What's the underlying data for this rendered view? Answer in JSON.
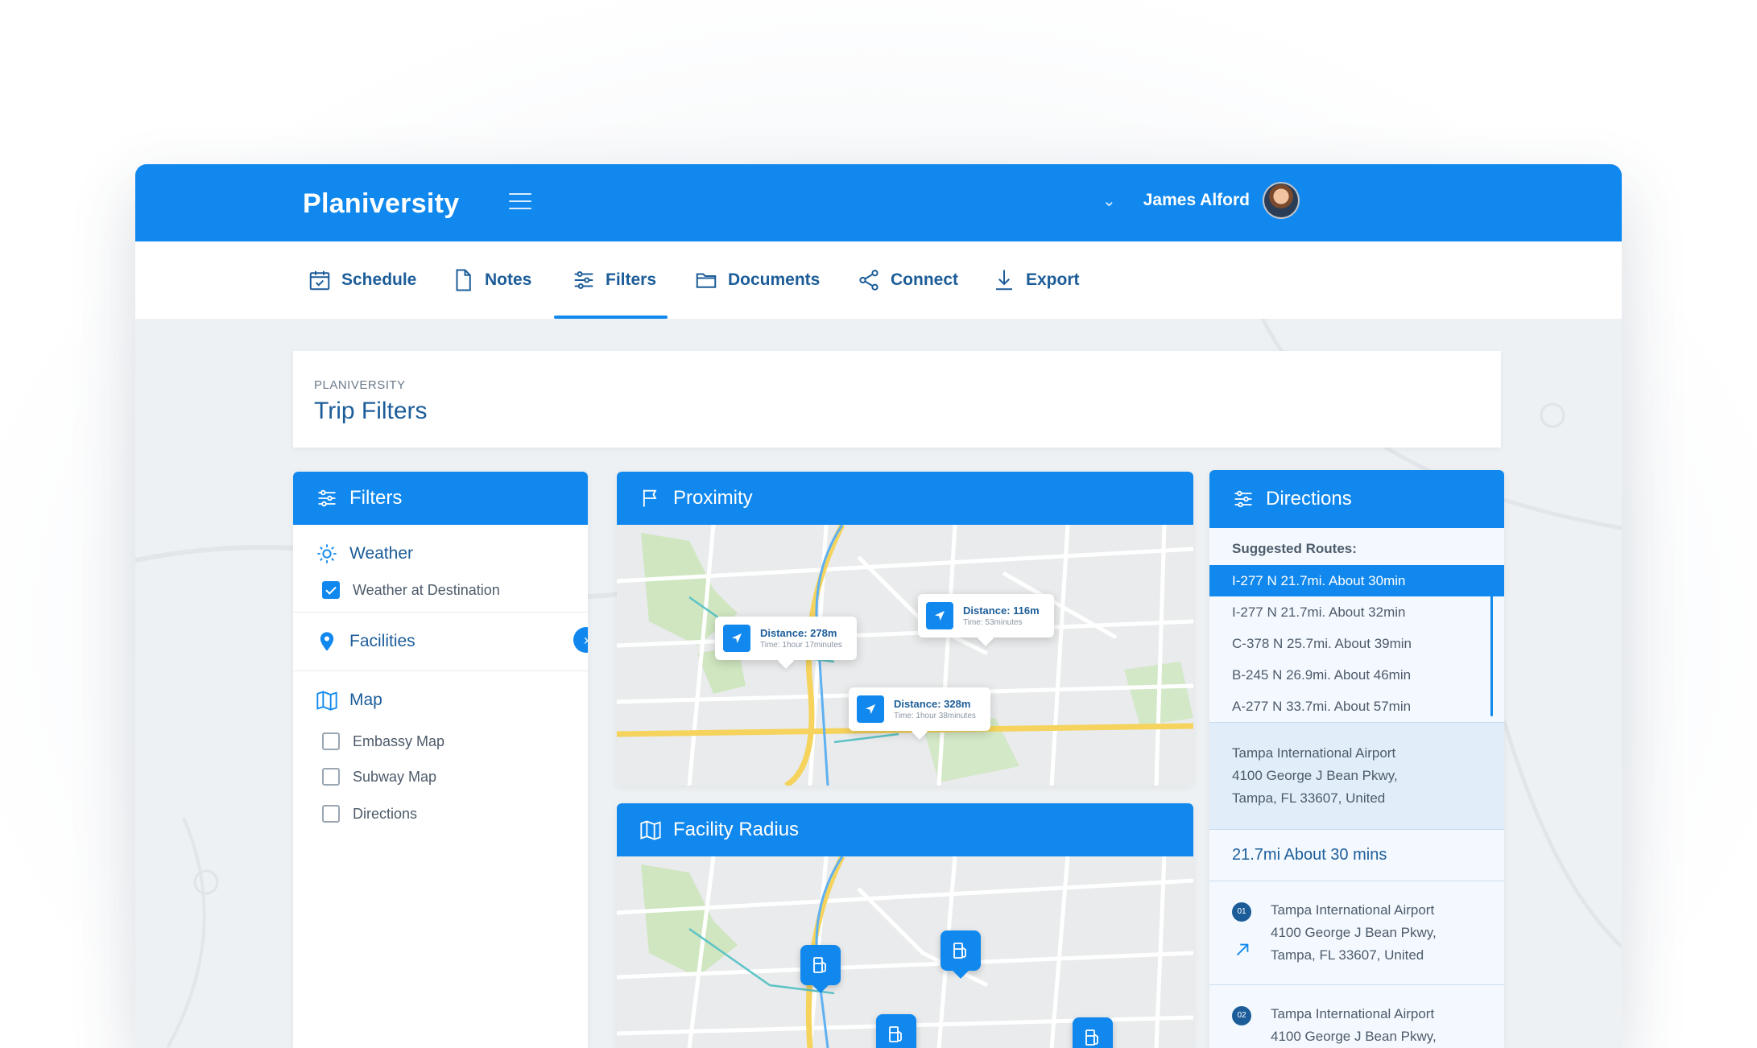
{
  "header": {
    "brand": "Planiversity",
    "user_name": "James Alford"
  },
  "tabs": [
    {
      "label": "Schedule"
    },
    {
      "label": "Notes"
    },
    {
      "label": "Filters"
    },
    {
      "label": "Documents"
    },
    {
      "label": "Connect"
    },
    {
      "label": "Export"
    }
  ],
  "active_tab": "Filters",
  "page": {
    "breadcrumb": "PLANIVERSITY",
    "title": "Trip Filters"
  },
  "filters": {
    "title": "Filters",
    "weather": {
      "label": "Weather",
      "options": [
        {
          "label": "Weather at Destination",
          "checked": true
        }
      ]
    },
    "facilities": {
      "label": "Facilities"
    },
    "map": {
      "label": "Map",
      "options": [
        {
          "label": "Embassy Map",
          "checked": false
        },
        {
          "label": "Subway Map",
          "checked": false
        },
        {
          "label": "Directions",
          "checked": false
        }
      ]
    }
  },
  "proximity": {
    "title": "Proximity",
    "markers": [
      {
        "distance": "Distance: 278m",
        "time": "Time: 1hour 17minutes"
      },
      {
        "distance": "Distance: 116m",
        "time": "Time: 53minutes"
      },
      {
        "distance": "Distance: 328m",
        "time": "Time: 1hour 38minutes"
      }
    ]
  },
  "facility_radius": {
    "title": "Facility Radius"
  },
  "directions": {
    "title": "Directions",
    "suggested_label": "Suggested Routes:",
    "routes": [
      {
        "label": "I-277 N 21.7mi. About 30min",
        "selected": true
      },
      {
        "label": "I-277 N 21.7mi. About 32min",
        "selected": false
      },
      {
        "label": "C-378 N 25.7mi. About 39min",
        "selected": false
      },
      {
        "label": "B-245 N 26.9mi. About 46min",
        "selected": false
      },
      {
        "label": "A-277 N 33.7mi. About 57min",
        "selected": false
      }
    ],
    "destination": {
      "line1": "Tampa International Airport",
      "line2": "4100 George J Bean Pkwy,",
      "line3": "Tampa, FL 33607, United"
    },
    "summary": "21.7mi About 30 mins",
    "steps": [
      {
        "num": "01",
        "line1": "Tampa International Airport",
        "line2": "4100 George J Bean Pkwy,",
        "line3": "Tampa, FL 33607, United"
      },
      {
        "num": "02",
        "line1": "Tampa International Airport",
        "line2": "4100 George J Bean Pkwy,",
        "line3": ""
      }
    ]
  },
  "colors": {
    "primary": "#1188ee",
    "text_dark": "#1c5d99",
    "text_muted": "#4d5b6a"
  }
}
